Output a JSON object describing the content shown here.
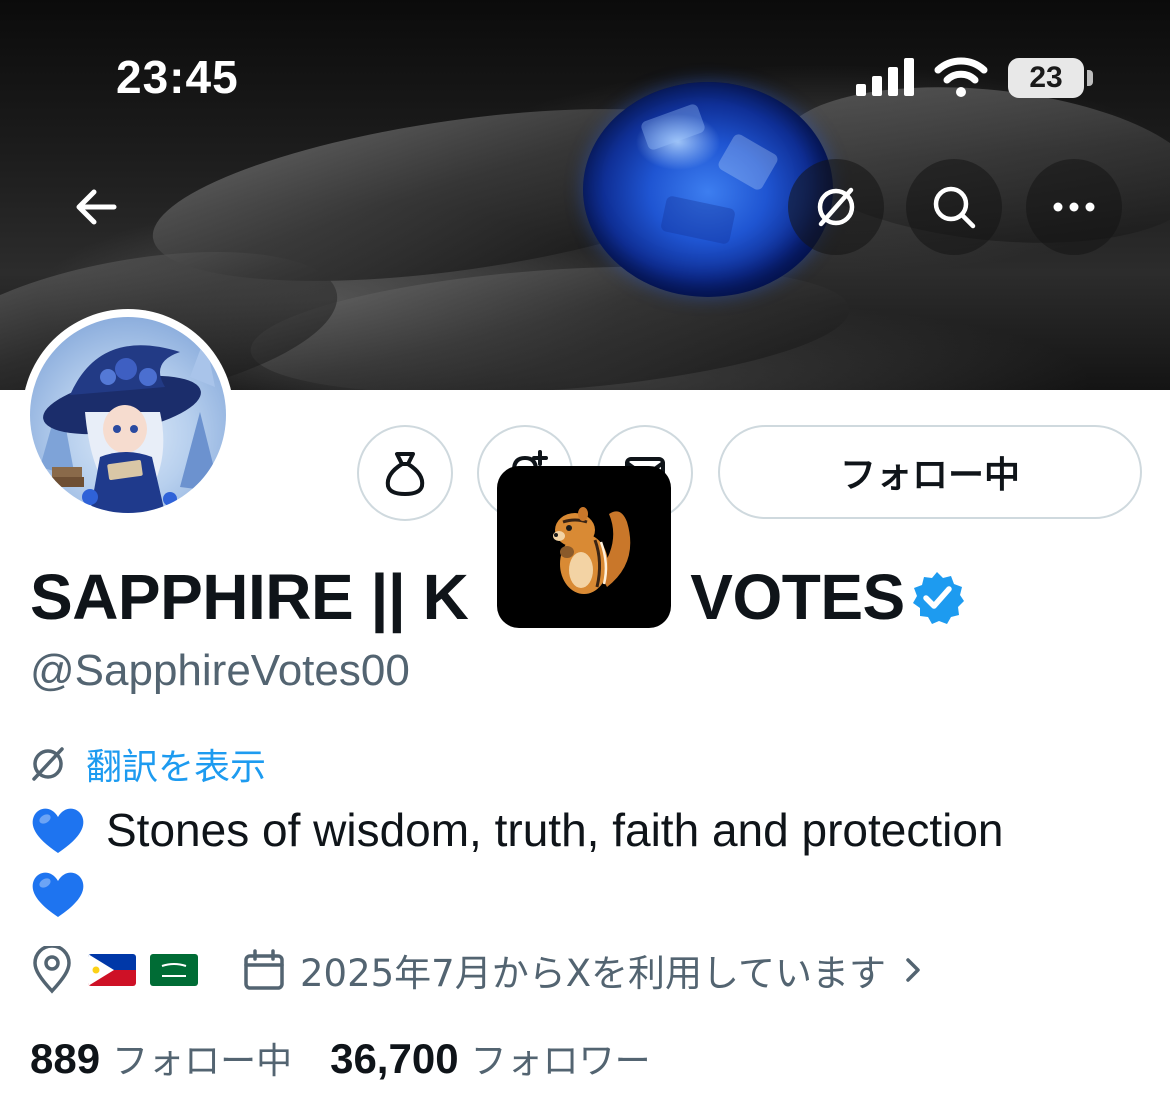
{
  "status_bar": {
    "time": "23:45",
    "battery": "23",
    "icons": [
      "cellular-signal-icon",
      "wifi-icon",
      "battery-icon"
    ]
  },
  "header": {
    "back_icon": "arrow-left-icon",
    "translate_icon": "translate-icon",
    "search_icon": "search-icon",
    "more_icon": "more-horizontal-icon"
  },
  "profile": {
    "display_name": "SAPPHIRE || K",
    "display_name_tail": "VOTES",
    "handle": "@SapphireVotes00",
    "verified": true,
    "verified_color": "#1d9bf0",
    "translate_label": "翻訳を表示",
    "bio": "Stones of wisdom, truth, faith and protection",
    "bio_emoji": "blue-heart",
    "location_flags": [
      "Philippines",
      "Saudi Arabia"
    ],
    "joined": "2025年7月からXを利用しています",
    "following_count": "889",
    "following_label": "フォロー中",
    "followers_count": "36,700",
    "followers_label": "フォロワー"
  },
  "actions": {
    "tip_icon": "money-bag-icon",
    "notify_icon": "bell-plus-icon",
    "message_icon": "message-icon",
    "follow_button_label": "フォロー中"
  },
  "overlay": {
    "sticker_icon": "chipmunk-sticker"
  },
  "colors": {
    "accent": "#1d9bf0",
    "text_primary": "#0f1419",
    "text_secondary": "#536471",
    "border": "#cfd9de"
  }
}
